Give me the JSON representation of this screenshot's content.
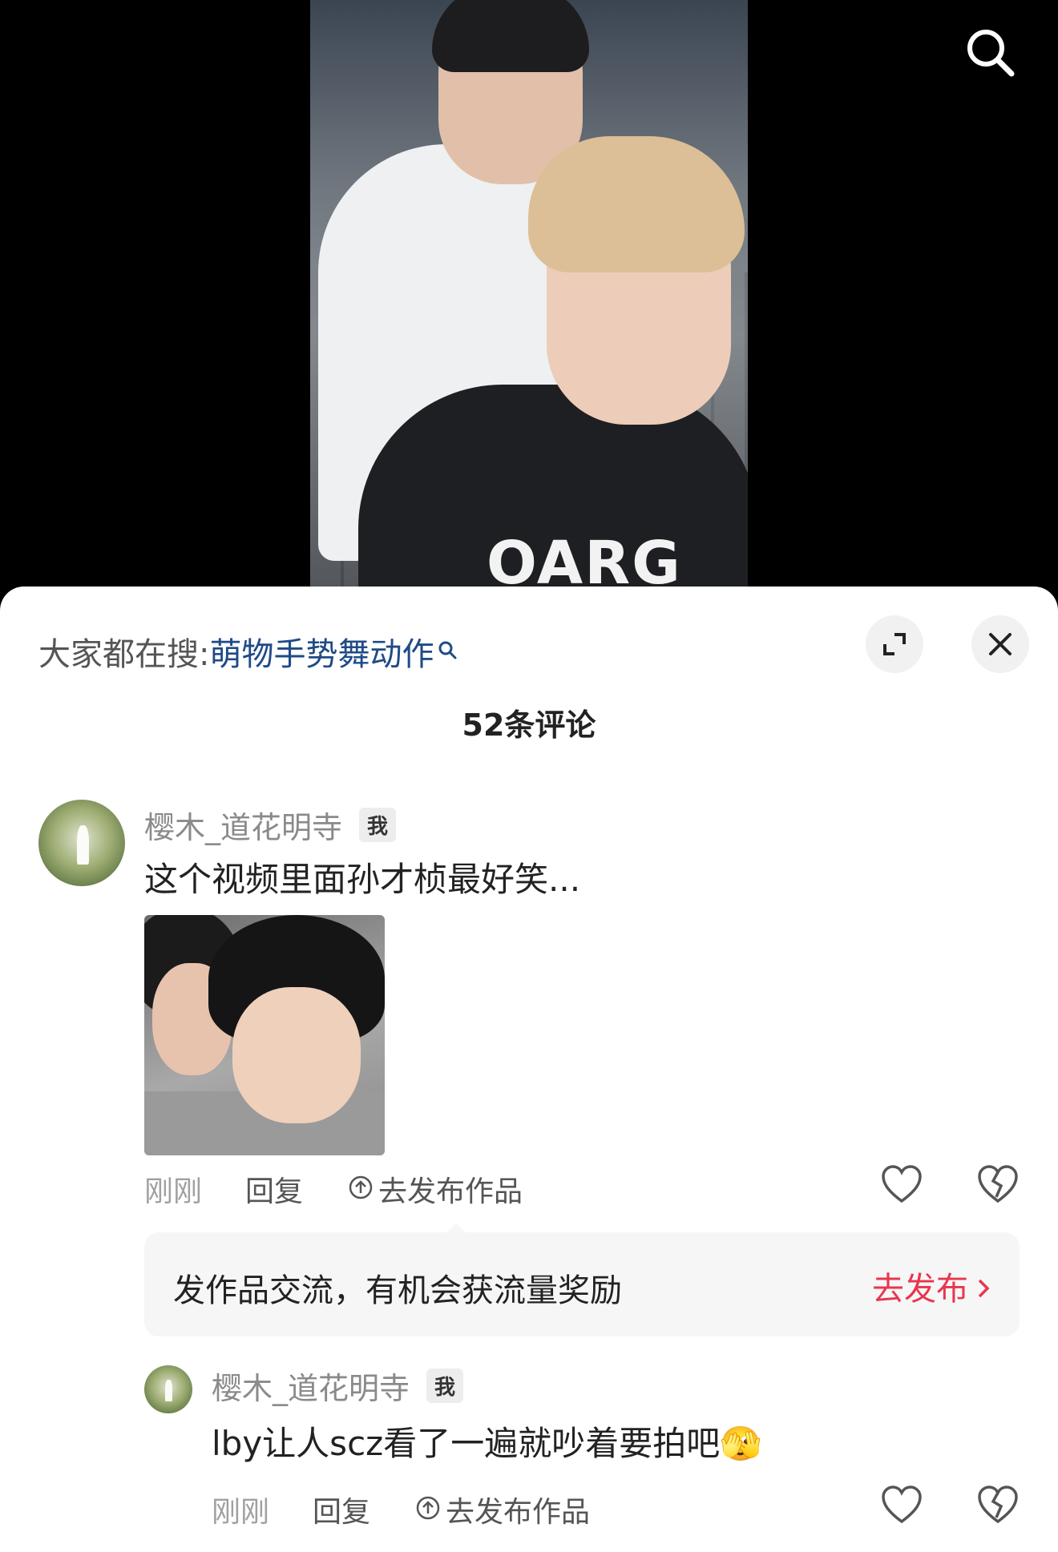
{
  "video": {
    "shirt_text": "OARG"
  },
  "sheet": {
    "hot_search_prefix": "大家都在搜:",
    "hot_search_keyword": "萌物手势舞动作",
    "comment_count": "52条评论"
  },
  "comments": [
    {
      "username": "樱木_道花明寺",
      "badge": "我",
      "text": "这个视频里面孙才桢最好笑...",
      "time": "刚刚",
      "reply": "回复",
      "publish": "去发布作品"
    },
    {
      "username": "樱木_道花明寺",
      "badge": "我",
      "text": "lby让人scz看了一遍就吵着要拍吧",
      "emoji": "🫣",
      "time": "刚刚",
      "reply": "回复",
      "publish": "去发布作品"
    }
  ],
  "promo": {
    "text": "发作品交流，有机会获流量奖励",
    "button": "去发布"
  },
  "colors": {
    "link_blue": "#1f4b87",
    "accent_red": "#e8364f"
  },
  "icons": [
    "search-icon",
    "expand-icon",
    "close-icon",
    "upload-icon",
    "heart-icon",
    "dislike-icon",
    "chevron-right-icon"
  ]
}
